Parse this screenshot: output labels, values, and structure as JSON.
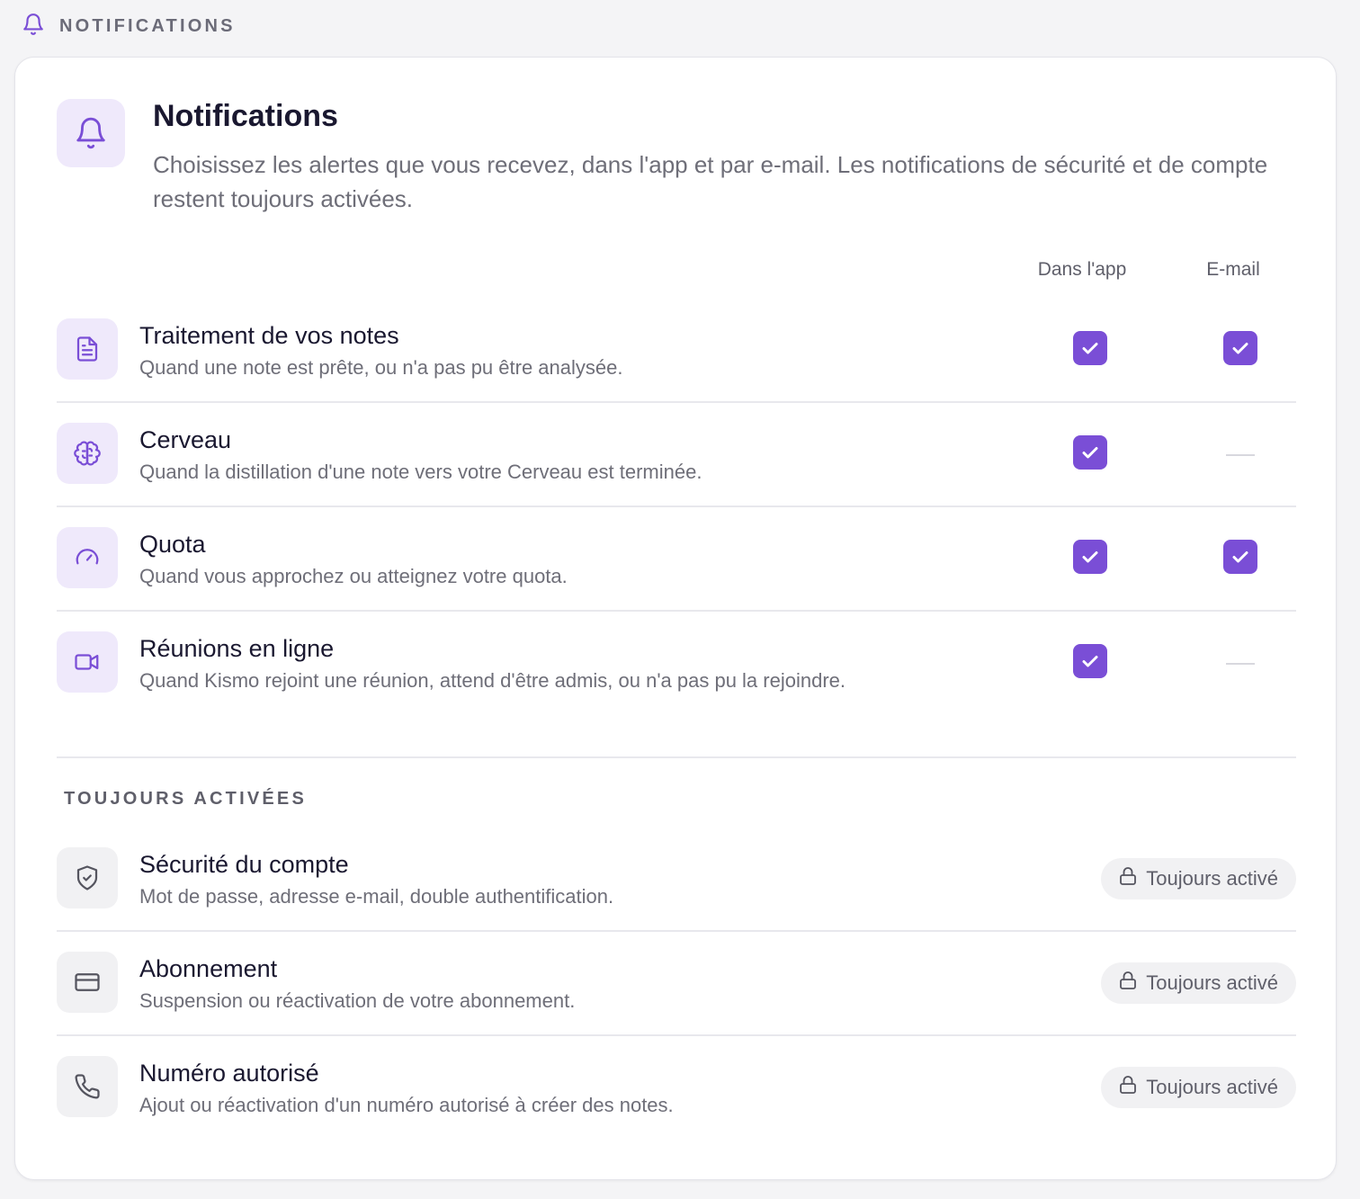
{
  "section": {
    "label": "NOTIFICATIONS",
    "icon": "bell-icon"
  },
  "hero": {
    "icon": "bell-icon",
    "title": "Notifications",
    "description": "Choisissez les alertes que vous recevez, dans l'app et par e-mail. Les notifications de sécurité et de compte restent toujours activées."
  },
  "columns": {
    "app": "Dans l'app",
    "email": "E-mail"
  },
  "preferences": [
    {
      "icon": "document-icon",
      "title": "Traitement de vos notes",
      "subtitle": "Quand une note est prête, ou n'a pas pu être analysée.",
      "in_app": true,
      "email": true
    },
    {
      "icon": "brain-icon",
      "title": "Cerveau",
      "subtitle": "Quand la distillation d'une note vers votre Cerveau est terminée.",
      "in_app": true,
      "email": null
    },
    {
      "icon": "gauge-icon",
      "title": "Quota",
      "subtitle": "Quand vous approchez ou atteignez votre quota.",
      "in_app": true,
      "email": true
    },
    {
      "icon": "video-icon",
      "title": "Réunions en ligne",
      "subtitle": "Quand Kismo rejoint une réunion, attend d'être admis, ou n'a pas pu la rejoindre.",
      "in_app": true,
      "email": null
    }
  ],
  "always_on": {
    "label": "TOUJOURS ACTIVÉES",
    "badge": "Toujours activé",
    "items": [
      {
        "icon": "shield-icon",
        "title": "Sécurité du compte",
        "subtitle": "Mot de passe, adresse e-mail, double authentification."
      },
      {
        "icon": "credit-card-icon",
        "title": "Abonnement",
        "subtitle": "Suspension ou réactivation de votre abonnement."
      },
      {
        "icon": "phone-icon",
        "title": "Numéro autorisé",
        "subtitle": "Ajout ou réactivation d'un numéro autorisé à créer des notes."
      }
    ]
  },
  "colors": {
    "accent": "#7a4ed6",
    "accent_soft": "#efe9fb",
    "text": "#1a1830",
    "muted": "#6e6e78"
  }
}
